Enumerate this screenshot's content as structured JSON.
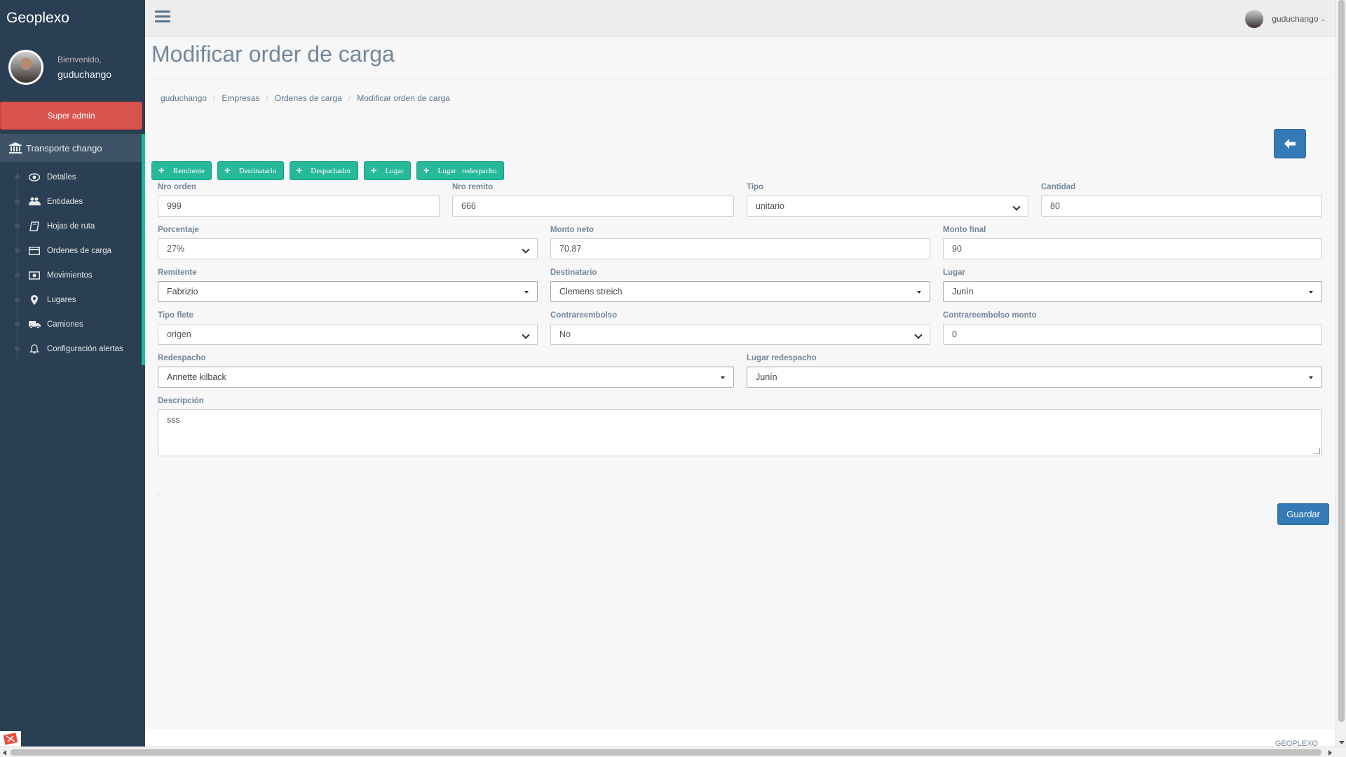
{
  "app": {
    "brand": "Geoplexo"
  },
  "profile": {
    "welcome": "Bienvenido,",
    "username": "guduchango",
    "role_button": "Super admin"
  },
  "sidebar": {
    "section": "Transporte chango",
    "items": [
      {
        "label": "Detalles",
        "icon": "eye-icon"
      },
      {
        "label": "Entidades",
        "icon": "users-icon"
      },
      {
        "label": "Hojas de ruta",
        "icon": "book-icon"
      },
      {
        "label": "Ordenes de carga",
        "icon": "credit-card-icon"
      },
      {
        "label": "Movimientos",
        "icon": "money-icon"
      },
      {
        "label": "Lugares",
        "icon": "map-marker-icon"
      },
      {
        "label": "Camiones",
        "icon": "truck-icon"
      },
      {
        "label": "Configuración alertas",
        "icon": "bell-icon"
      }
    ]
  },
  "topbar": {
    "user": "guduchango"
  },
  "page": {
    "title": "Modificar order de carga"
  },
  "breadcrumb": [
    "guduchango",
    "Empresas",
    "Ordenes de carga",
    "Modificar orden de carga"
  ],
  "add_buttons": [
    "Remitente",
    "Destinatario",
    "Despachador",
    "Lugar",
    "Lugar   redespacho"
  ],
  "form": {
    "nro_orden": {
      "label": "Nro orden",
      "value": "999"
    },
    "nro_remito": {
      "label": "Nro remito",
      "value": "666"
    },
    "tipo": {
      "label": "Tipo",
      "value": "unitario"
    },
    "cantidad": {
      "label": "Cantidad",
      "value": "80"
    },
    "porcentaje": {
      "label": "Porcentaje",
      "value": "27%"
    },
    "monto_neto": {
      "label": "Monto neto",
      "value": "70.87"
    },
    "monto_final": {
      "label": "Monto final",
      "value": "90"
    },
    "remitente": {
      "label": "Remitente",
      "value": "Fabrizio"
    },
    "destinatario": {
      "label": "Destinatario",
      "value": "Clemens streich"
    },
    "lugar": {
      "label": "Lugar",
      "value": "Junín"
    },
    "tipo_flete": {
      "label": "Tipo flete",
      "value": "origen"
    },
    "contrareembolso": {
      "label": "Contrareembolso",
      "value": "No"
    },
    "contrareembolso_monto": {
      "label": "Contrareembolso monto",
      "value": "0"
    },
    "redespacho": {
      "label": "Redespacho",
      "value": "Annette kilback"
    },
    "lugar_redespacho": {
      "label": "Lugar redespacho",
      "value": "Junín"
    },
    "descripcion": {
      "label": "Descripción",
      "value": "sss"
    },
    "save_label": "Guardar"
  },
  "misc": {
    "dot": ":"
  },
  "footer": {
    "text": "GEOPLEXO"
  },
  "colors": {
    "sidebar": "#2a3f54",
    "accent_green": "#26b99a",
    "primary_blue": "#337ab7",
    "danger_red": "#d9534f"
  }
}
